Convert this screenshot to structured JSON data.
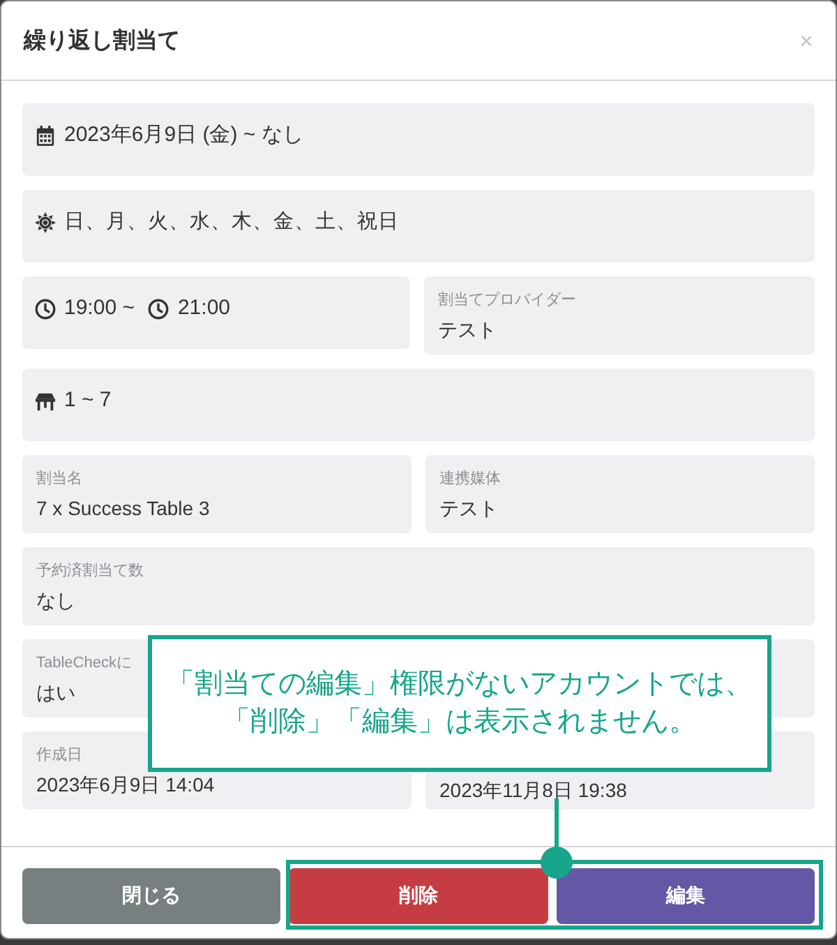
{
  "dialog": {
    "title": "繰り返し割当て",
    "close_label": "×"
  },
  "rows": [
    [
      {
        "kind": "date",
        "text": "2023年6月9日 (金) ~ なし"
      }
    ],
    [
      {
        "kind": "weekdays",
        "text": "日、月、火、水、木、金、土、祝日"
      }
    ],
    [
      {
        "kind": "time",
        "start": "19:00 ~",
        "end": "21:00"
      },
      {
        "kind": "detail",
        "label": "割当てプロバイダー",
        "value": "テスト"
      }
    ],
    [
      {
        "kind": "party",
        "text": "1 ~ 7"
      }
    ],
    [
      {
        "kind": "detail",
        "label": "割当名",
        "value": "7 x Success Table 3"
      },
      {
        "kind": "detail",
        "label": "連携媒体",
        "value": "テスト"
      }
    ],
    [
      {
        "kind": "detail",
        "label": "予約済割当て数",
        "value": "なし"
      }
    ],
    [
      {
        "kind": "detail",
        "label": "TableCheckに",
        "value": "はい"
      },
      {
        "kind": "detail"
      }
    ],
    [
      {
        "kind": "detail",
        "label": "作成日",
        "value": "2023年6月9日 14:04"
      },
      {
        "kind": "detail",
        "value": "2023年11月8日 19:38"
      }
    ]
  ],
  "buttons": [
    {
      "kind": "secondary",
      "label": "閉じる"
    },
    {
      "kind": "danger",
      "label": "削除"
    },
    {
      "kind": "primary",
      "label": "編集"
    }
  ],
  "annotation": {
    "lines": [
      "「割当ての編集」権限がないアカウントでは、",
      "「削除」「編集」は表示されません。"
    ]
  }
}
